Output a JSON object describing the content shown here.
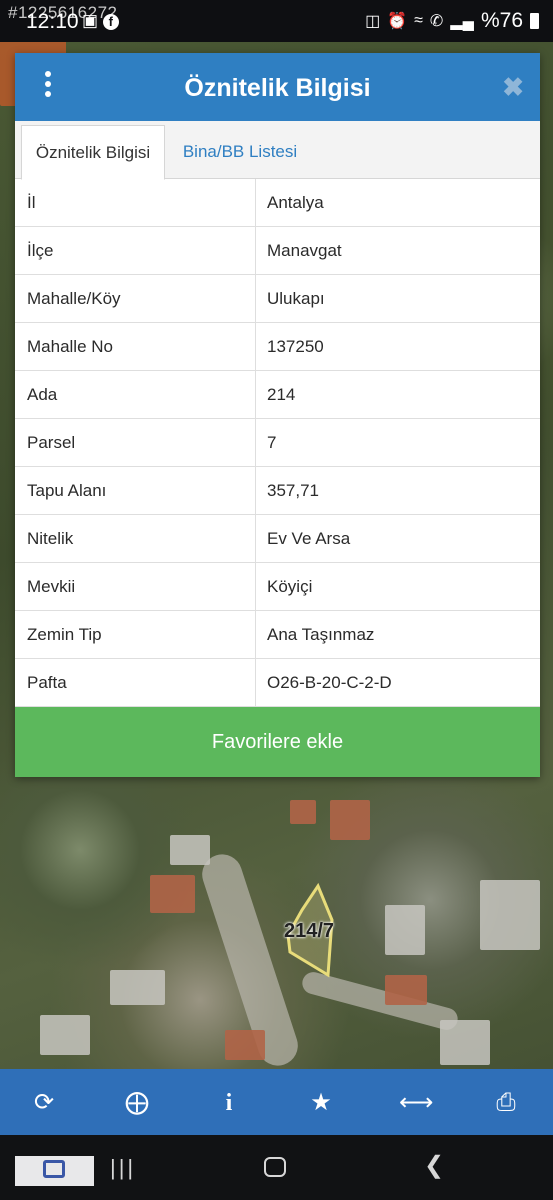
{
  "status_bar": {
    "time": "12:10",
    "watermark": "#1225616272",
    "battery": "%76"
  },
  "dialog": {
    "title": "Öznitelik Bilgisi",
    "tabs": [
      {
        "label": "Öznitelik Bilgisi",
        "active": true
      },
      {
        "label": "Bina/BB Listesi",
        "active": false
      }
    ],
    "rows": [
      {
        "key": "İl",
        "value": "Antalya"
      },
      {
        "key": "İlçe",
        "value": "Manavgat"
      },
      {
        "key": "Mahalle/Köy",
        "value": "Ulukapı"
      },
      {
        "key": "Mahalle No",
        "value": "137250"
      },
      {
        "key": "Ada",
        "value": "214"
      },
      {
        "key": "Parsel",
        "value": "7"
      },
      {
        "key": "Tapu Alanı",
        "value": "357,71"
      },
      {
        "key": "Nitelik",
        "value": "Ev Ve Arsa"
      },
      {
        "key": "Mevkii",
        "value": "Köyiçi"
      },
      {
        "key": "Zemin Tip",
        "value": "Ana Taşınmaz"
      },
      {
        "key": "Pafta",
        "value": "O26-B-20-C-2-D"
      }
    ],
    "favorite_button": "Favorilere ekle"
  },
  "map": {
    "parcel_label": "214/7"
  },
  "toolbar": {
    "icons": [
      "refresh-icon",
      "locate-icon",
      "info-icon",
      "star-icon",
      "measure-icon",
      "print-icon"
    ]
  },
  "colors": {
    "header_blue": "#2f7fc2",
    "toolbar_blue": "#2f6fb8",
    "button_green": "#5cb85c"
  }
}
